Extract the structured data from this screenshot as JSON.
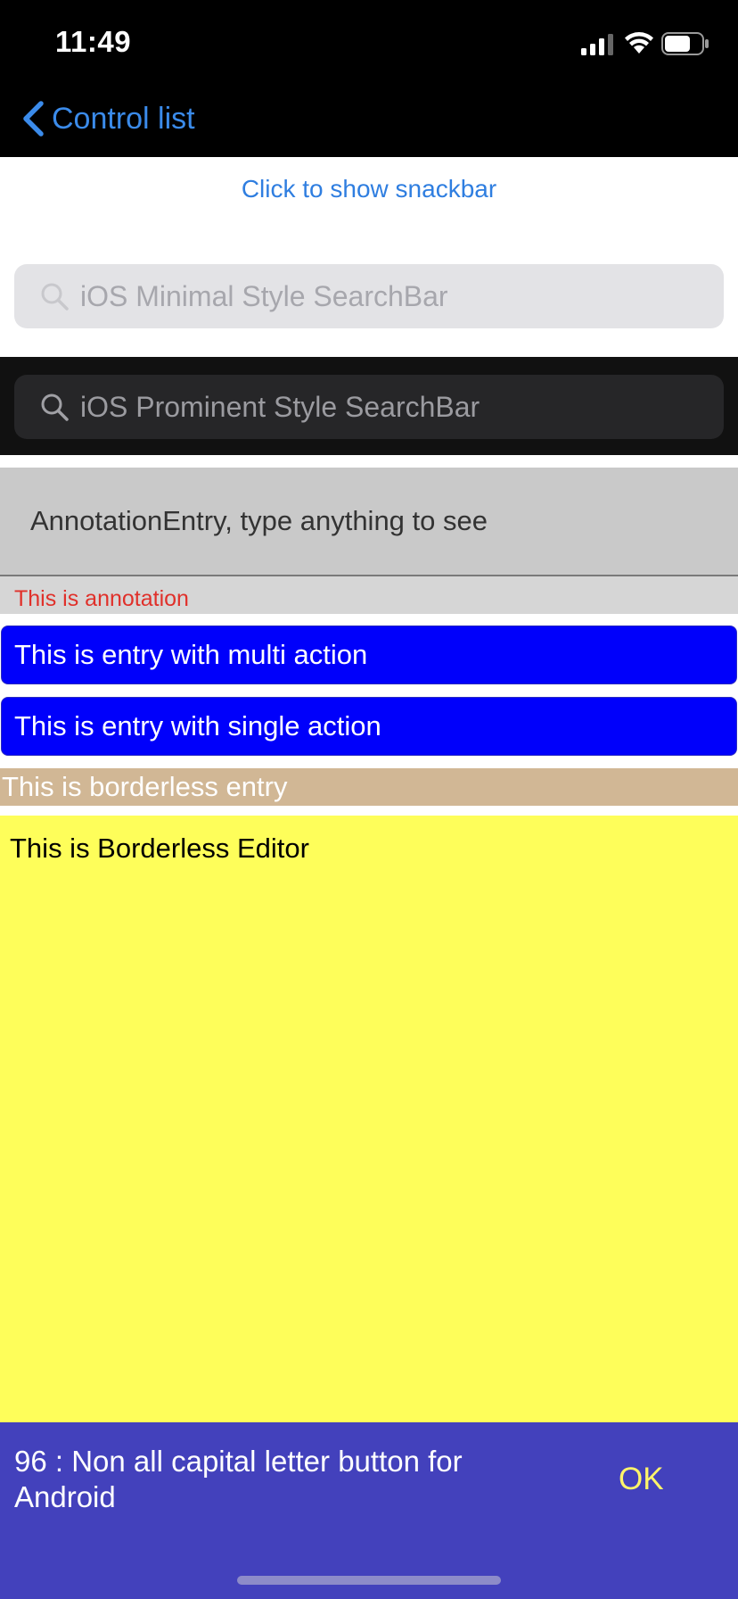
{
  "status_bar": {
    "time": "11:49",
    "signal_icon": "cellular-signal-icon",
    "wifi_icon": "wifi-icon",
    "battery_icon": "battery-icon"
  },
  "nav": {
    "back_label": "Control list",
    "back_icon": "chevron-left-icon",
    "accent_color": "#3b8bea"
  },
  "snackbar_link": "Click to show snackbar",
  "search_minimal": {
    "placeholder": "iOS Minimal Style SearchBar",
    "icon": "search-icon"
  },
  "search_prominent": {
    "placeholder": "iOS Prominent Style SearchBar",
    "icon": "search-icon"
  },
  "annotation_entry": {
    "placeholder": "AnnotationEntry, type anything to see",
    "annotation": "This is annotation",
    "annotation_color": "#e0302a"
  },
  "multi_action_entry": "This is entry with multi action",
  "single_action_entry": "This is entry with single action",
  "borderless_entry": "This is borderless entry",
  "borderless_editor": "This is Borderless Editor",
  "snackbar": {
    "message": "96 : Non all capital letter button for Android",
    "action": "OK",
    "background": "#4341bc",
    "action_color": "#fff46a"
  },
  "colors": {
    "entry_blue": "#0000fb",
    "borderless_entry_bg": "#d1b795",
    "editor_bg": "#fefe5a"
  }
}
